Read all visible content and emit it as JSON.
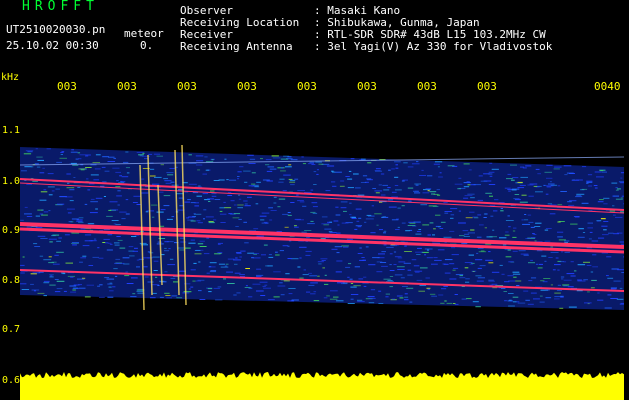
{
  "header": {
    "app_title": "HROFFT",
    "file_name": "UT2510020030.pn",
    "mode_label": "meteor",
    "datetime": "25.10.02 00:30",
    "count": "0."
  },
  "info": [
    {
      "key": "Observer",
      "value": ": Masaki Kano"
    },
    {
      "key": "Receiving Location",
      "value": ": Shibukawa, Gunma, Japan"
    },
    {
      "key": "Receiver",
      "value": ": RTL-SDR SDR# 43dB L15 103.2MHz CW"
    },
    {
      "key": "Receiving Antenna",
      "value": ": 3el Yagi(V) Az 330 for Vladivostok"
    }
  ],
  "axis": {
    "unit": "kHz",
    "y_ticks": [
      "1.1",
      "1.0",
      "0.9",
      "0.8",
      "0.7",
      "0.6"
    ],
    "x_ticks": [
      "003",
      "003",
      "003",
      "003",
      "003",
      "003",
      "003",
      "003",
      "0040"
    ]
  },
  "colors": {
    "background": "#000000",
    "title_green": "#00ff33",
    "axis_yellow": "#ffff00",
    "noise_blue": "#1030c0",
    "signal_pink": "#ff3366",
    "level_yellow": "#ffff00"
  }
}
